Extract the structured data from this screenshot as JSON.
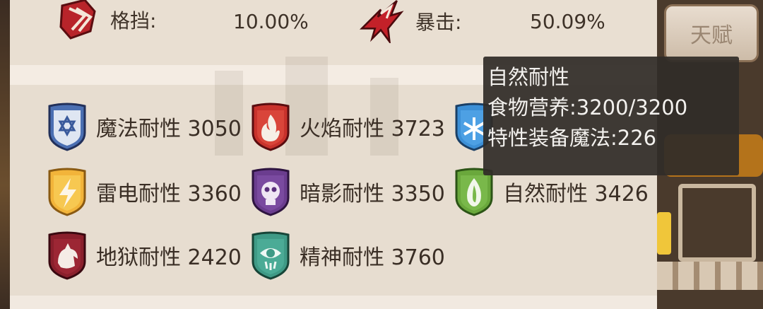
{
  "tabs": {
    "talent_label": "天赋"
  },
  "stats": {
    "block": {
      "label": "格挡:",
      "value": "10.00%"
    },
    "crit": {
      "label": "暴击:",
      "value": "50.09%"
    }
  },
  "resistances": [
    {
      "label": "魔法耐性 3050",
      "icon": "magic-shield-icon",
      "color": "#4b6fb2"
    },
    {
      "label": "火焰耐性 3723",
      "icon": "fire-shield-icon",
      "color": "#c8322c"
    },
    {
      "label": "",
      "icon": "ice-shield-icon",
      "color": "#3c8fd6"
    },
    {
      "label": "雷电耐性 3360",
      "icon": "thunder-shield-icon",
      "color": "#f2b43a"
    },
    {
      "label": "暗影耐性 3350",
      "icon": "shadow-shield-icon",
      "color": "#6b3d8f"
    },
    {
      "label": "自然耐性 3426",
      "icon": "nature-shield-icon",
      "color": "#6aa83c"
    },
    {
      "label": "地狱耐性 2420",
      "icon": "hell-shield-icon",
      "color": "#8a1f2c"
    },
    {
      "label": "精神耐性 3760",
      "icon": "spirit-shield-icon",
      "color": "#3f9a86"
    }
  ],
  "tooltip": {
    "title": "自然耐性",
    "line1": "食物营养:3200/3200",
    "line2": "特性装备魔法:226"
  }
}
